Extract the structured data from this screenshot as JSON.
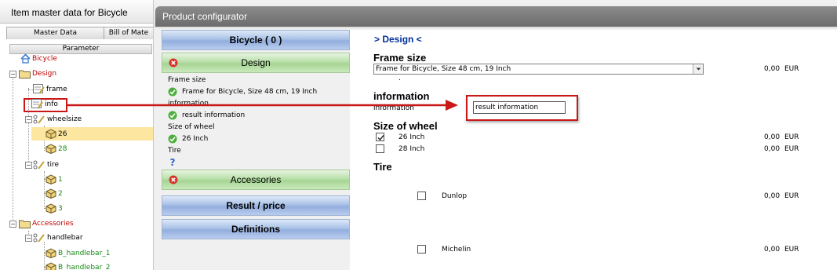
{
  "left_window": {
    "title": "Item master data for Bicycle",
    "tabs": [
      "Master Data",
      "Bill of Mate"
    ],
    "param_header": "Parameter"
  },
  "tree": {
    "bicycle": "Bicycle",
    "design": "Design",
    "frame": "frame",
    "info": "info",
    "wheelsize": "wheelsize",
    "w26": "26",
    "w28": "28",
    "tire": "tire",
    "t1": "1",
    "t2": "2",
    "t3": "3",
    "accessories": "Accessories",
    "handlebar": "handlebar",
    "hb1": "B_handlebar_1",
    "hb2": "B_handlebar_2"
  },
  "right_window": {
    "title": "Product configurator"
  },
  "nav": {
    "bicycle": "Bicycle  ( 0 )",
    "design": "Design",
    "accessories": "Accessories",
    "result": "Result / price",
    "definitions": "Definitions",
    "summary": [
      {
        "label": "Frame size",
        "value": "Frame for Bicycle, Size 48 cm, 19 Inch"
      },
      {
        "label": "information",
        "value": "result information"
      },
      {
        "label": "Size of wheel",
        "value": "26 Inch"
      },
      {
        "label": "Tire",
        "value": ""
      }
    ]
  },
  "form": {
    "heading": "> Design <",
    "frame_size": {
      "title": "Frame size",
      "selected": "Frame for Bicycle, Size 48 cm, 19 Inch",
      "note": ".",
      "price": "0,00",
      "currency": "EUR"
    },
    "information": {
      "title": "information",
      "label": "information",
      "value": "result information"
    },
    "wheel": {
      "title": "Size of wheel",
      "options": [
        {
          "label": "26 Inch",
          "checked": true,
          "price": "0,00",
          "currency": "EUR"
        },
        {
          "label": "28 Inch",
          "checked": false,
          "price": "0,00",
          "currency": "EUR"
        }
      ]
    },
    "tire": {
      "title": "Tire",
      "options": [
        {
          "label": "Dunlop",
          "checked": false,
          "price": "0,00",
          "currency": "EUR"
        },
        {
          "label": "Michelin",
          "checked": false,
          "price": "0,00",
          "currency": "EUR"
        }
      ]
    }
  },
  "colors": {
    "accent_blue": "#0030a0",
    "callout_red": "#c81818",
    "tree_red": "#c00000",
    "tree_green": "#178a17",
    "selection": "#fde6a0"
  }
}
